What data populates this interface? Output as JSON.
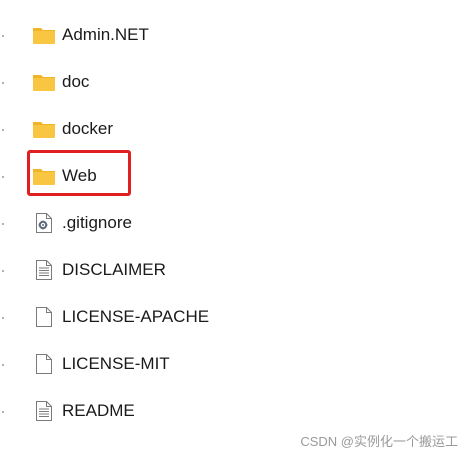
{
  "files": [
    {
      "label": "Admin.NET",
      "icon": "folder-icon"
    },
    {
      "label": "doc",
      "icon": "folder-icon"
    },
    {
      "label": "docker",
      "icon": "folder-icon"
    },
    {
      "label": "Web",
      "icon": "folder-icon"
    },
    {
      "label": ".gitignore",
      "icon": "config-file-icon"
    },
    {
      "label": "DISCLAIMER",
      "icon": "text-file-icon"
    },
    {
      "label": "LICENSE-APACHE",
      "icon": "blank-file-icon"
    },
    {
      "label": "LICENSE-MIT",
      "icon": "blank-file-icon"
    },
    {
      "label": "README",
      "icon": "text-file-icon"
    }
  ],
  "watermark": "CSDN @实例化一个搬运工",
  "colors": {
    "folder_body": "#f8c640",
    "folder_tab": "#f0b429",
    "highlight": "#e02020",
    "text": "#1a1a1a"
  }
}
